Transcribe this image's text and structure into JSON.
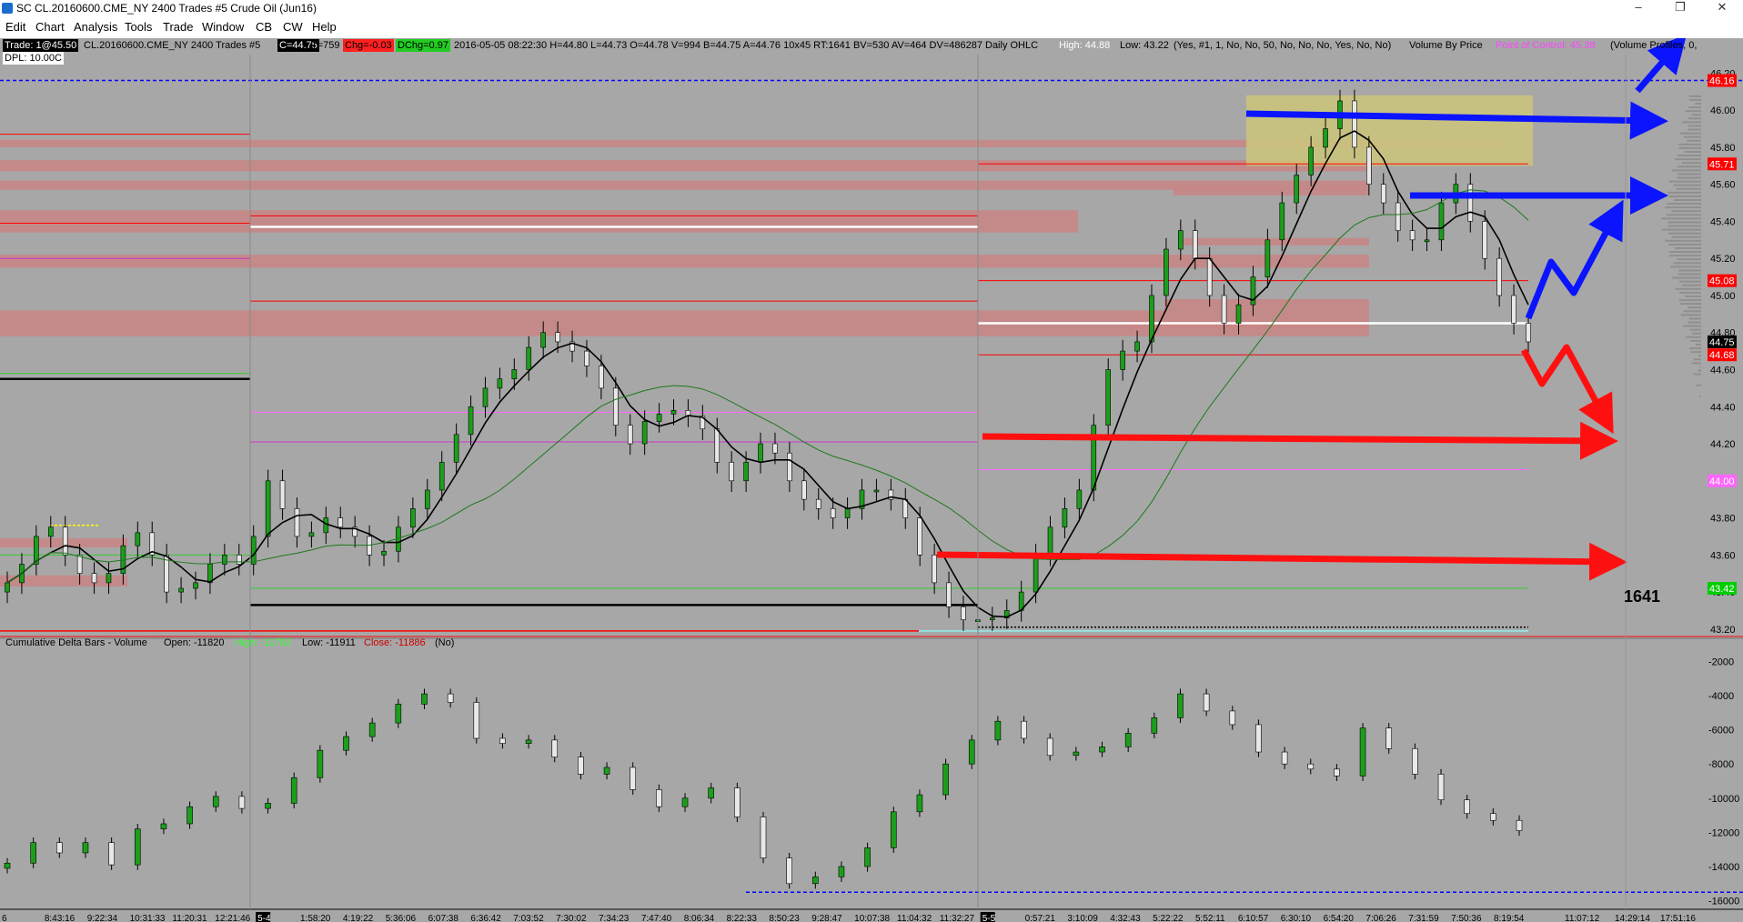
{
  "window": {
    "title": "SC CL.20160600.CME_NY  2400 Trades  #5  Crude Oil (Jun16)",
    "minimize_icon": "minimize-icon",
    "restore_icon": "restore-icon",
    "close_icon": "close-icon"
  },
  "menu": [
    "Edit",
    "Chart",
    "Analysis",
    "Tools",
    "Trade",
    "Window",
    "CB",
    "CW",
    "Help"
  ],
  "header": {
    "trade": "Trade: 1@45.50",
    "symbol": "CL.20160600.CME_NY  2400 Trades  #5",
    "last": "C=44.75",
    "trades": "T=759",
    "chg": "Chg=-0.03",
    "dchg": "DChg=0.97",
    "stats": "2016-05-05 08:22:30 H=44.80 L=44.73 O=44.78 V=994 B=44.75 A=44.76 10x45 RT:1641 BV=530 AV=464 DV=486287 Daily OHLC",
    "daily_high": "High: 44.88",
    "daily_low": "Low: 43.22",
    "vbp_params": "(Yes, #1, 1, No, No, 50, No, No, No, Yes, No, No)",
    "vbp_label": "Volume By Price",
    "poc": "Point of Control: 45.38",
    "profiles": "(Volume Profiles, 0,",
    "dpl": "DPL: 10.00C"
  },
  "price_axis": {
    "ticks": [
      "46.20",
      "46.00",
      "45.80",
      "45.60",
      "45.40",
      "45.20",
      "45.00",
      "44.80",
      "44.60",
      "44.40",
      "44.20",
      "44.00",
      "43.80",
      "43.60",
      "43.40",
      "43.20"
    ],
    "markers": [
      {
        "label": "46.16",
        "value": 46.16,
        "color": "#ff0000"
      },
      {
        "label": "45.71",
        "value": 45.71,
        "color": "#ff0000"
      },
      {
        "label": "45.08",
        "value": 45.08,
        "color": "#ff0000"
      },
      {
        "label": "44.75",
        "value": 44.75,
        "color": "#000000"
      },
      {
        "label": "44.68",
        "value": 44.68,
        "color": "#ff0000"
      },
      {
        "label": "44.00",
        "value": 44.0,
        "color": "#ff66ff"
      },
      {
        "label": "43.42",
        "value": 43.42,
        "color": "#00cc00"
      }
    ]
  },
  "annotation_count": "1641",
  "delta": {
    "title": "Cumulative Delta Bars - Volume",
    "open": "Open: -11820",
    "high": "High: -11782",
    "low": "Low: -11911",
    "close": "Close: -11886",
    "flag": "(No)",
    "ticks": [
      "-2000",
      "-4000",
      "-6000",
      "-8000",
      "-10000",
      "-12000",
      "-14000",
      "-16000"
    ]
  },
  "time_axis": {
    "labels": [
      "6",
      "8:43:16",
      "9:22:34",
      "10:31:33",
      "11:20:31",
      "12:21:46",
      "5-4",
      "1:58:20",
      "4:19:22",
      "5:36:06",
      "6:07:38",
      "6:36:42",
      "7:03:52",
      "7:30:02",
      "7:34:23",
      "7:47:40",
      "8:06:34",
      "8:22:33",
      "8:50:23",
      "9:28:47",
      "10:07:38",
      "11:04:32",
      "11:32:27",
      "5-5",
      "0:57:21",
      "3:10:09",
      "4:32:43",
      "5:22:22",
      "5:52:11",
      "6:10:57",
      "6:30:10",
      "6:54:20",
      "7:06:26",
      "7:31:59",
      "7:50:36",
      "8:19:54",
      "11:07:12",
      "14:29:14",
      "17:51:16"
    ]
  },
  "chart_data": {
    "type": "candlestick",
    "price_ylim": [
      43.16,
      46.3
    ],
    "delta_ylim": [
      -16500,
      -1500
    ],
    "price_close": [
      43.45,
      43.55,
      43.7,
      43.75,
      43.6,
      43.5,
      43.45,
      43.5,
      43.65,
      43.72,
      43.6,
      43.4,
      43.42,
      43.45,
      43.55,
      43.6,
      43.55,
      43.7,
      44.0,
      43.85,
      43.7,
      43.72,
      43.8,
      43.75,
      43.7,
      43.6,
      43.62,
      43.75,
      43.85,
      43.95,
      44.1,
      44.25,
      44.4,
      44.5,
      44.55,
      44.6,
      44.72,
      44.8,
      44.75,
      44.7,
      44.62,
      44.5,
      44.3,
      44.2,
      44.32,
      44.36,
      44.38,
      44.35,
      44.28,
      44.1,
      44.0,
      44.1,
      44.2,
      44.15,
      44.0,
      43.9,
      43.85,
      43.8,
      43.85,
      43.95,
      43.95,
      43.9,
      43.8,
      43.6,
      43.45,
      43.32,
      43.25,
      43.25,
      43.26,
      43.3,
      43.4,
      43.6,
      43.75,
      43.85,
      43.95,
      44.3,
      44.6,
      44.7,
      44.75,
      45.0,
      45.25,
      45.35,
      45.2,
      45.0,
      44.85,
      44.95,
      45.1,
      45.3,
      45.5,
      45.65,
      45.8,
      45.9,
      46.05,
      45.8,
      45.6,
      45.5,
      45.35,
      45.3,
      45.3,
      45.5,
      45.6,
      45.4,
      45.2,
      45.0,
      44.85,
      44.75
    ],
    "delta_close": [
      -13800,
      -12600,
      -13200,
      -12600,
      -13900,
      -11800,
      -11500,
      -10500,
      -9900,
      -10600,
      -10300,
      -8800,
      -7200,
      -6400,
      -5600,
      -4500,
      -3900,
      -4400,
      -6500,
      -6800,
      -6600,
      -7600,
      -8600,
      -8200,
      -9500,
      -10500,
      -10000,
      -9400,
      -11100,
      -13500,
      -15000,
      -14600,
      -14000,
      -12900,
      -10800,
      -9800,
      -8000,
      -6600,
      -5500,
      -6500,
      -7500,
      -7300,
      -7000,
      -6200,
      -5300,
      -3900,
      -4900,
      -5700,
      -7300,
      -8000,
      -8300,
      -8700,
      -5900,
      -7100,
      -8600,
      -10100,
      -10900,
      -11300,
      -11900
    ]
  }
}
